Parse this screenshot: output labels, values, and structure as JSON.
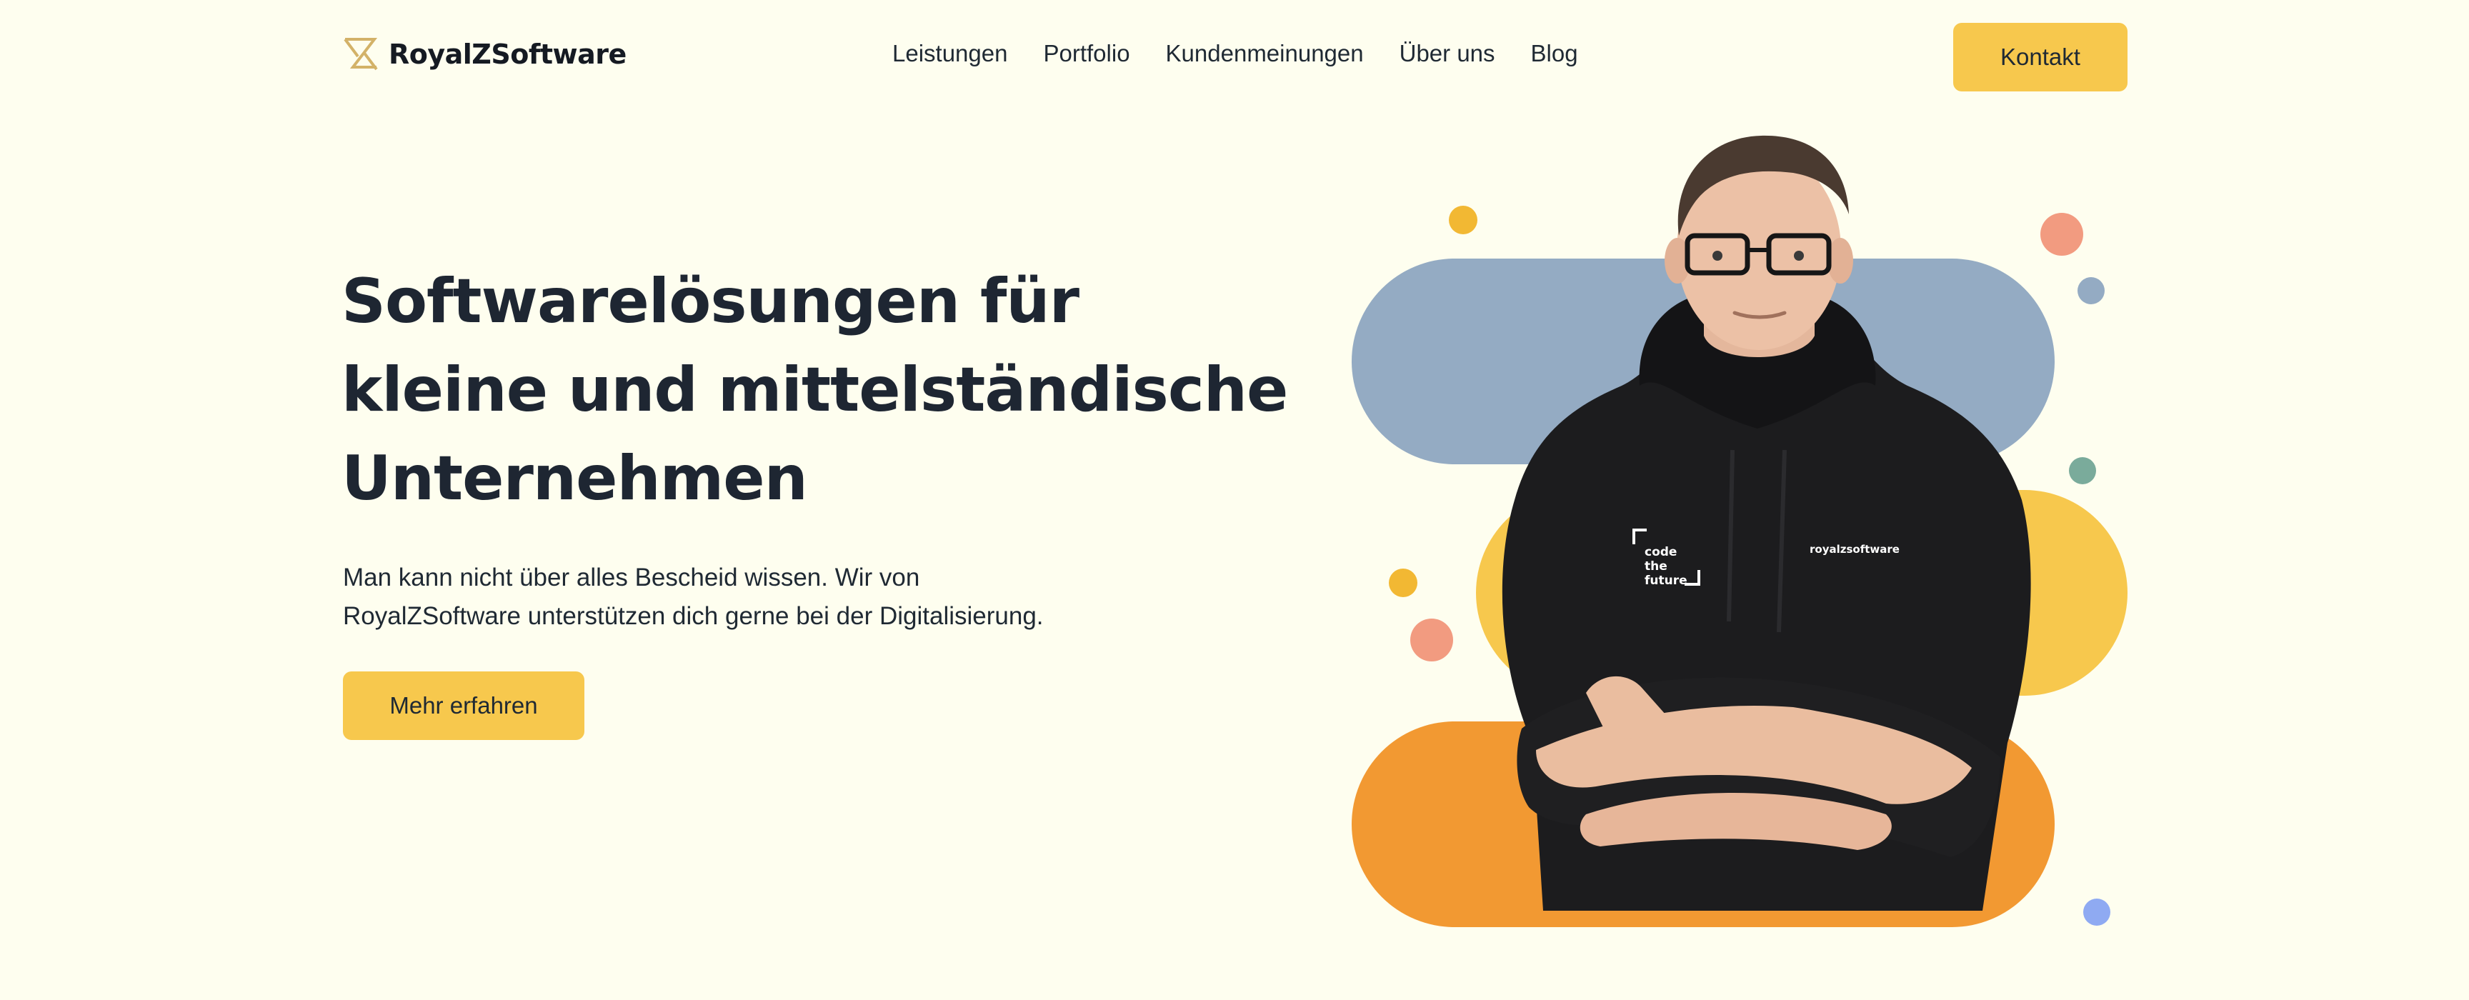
{
  "brand": {
    "name": "RoyalZSoftware"
  },
  "nav": {
    "items": [
      {
        "label": "Leistungen"
      },
      {
        "label": "Portfolio"
      },
      {
        "label": "Kundenmeinungen"
      },
      {
        "label": "Über uns"
      },
      {
        "label": "Blog"
      }
    ],
    "contact_label": "Kontakt"
  },
  "hero": {
    "headline_lines": [
      "Softwarelösungen für",
      "kleine und mittelständische",
      "Unternehmen"
    ],
    "subtext_lines": [
      "Man kann nicht über alles Bescheid wissen. Wir von",
      "RoyalZSoftware unterstützen dich gerne bei der Digitalisierung."
    ],
    "cta_label": "Mehr erfahren"
  },
  "illustration": {
    "hoodie_left_print": [
      "code",
      "the",
      "future"
    ],
    "hoodie_right_print": "royalzsoftware"
  },
  "colors": {
    "background": "#fefeef",
    "accent_yellow": "#f7c84d",
    "pill_blue": "#94abc3",
    "pill_orange": "#f29932",
    "dot_salmon": "#f29b80",
    "dot_teal": "#7aab9b",
    "dot_periwinkle": "#8faaf2",
    "text_dark": "#1e2632"
  }
}
